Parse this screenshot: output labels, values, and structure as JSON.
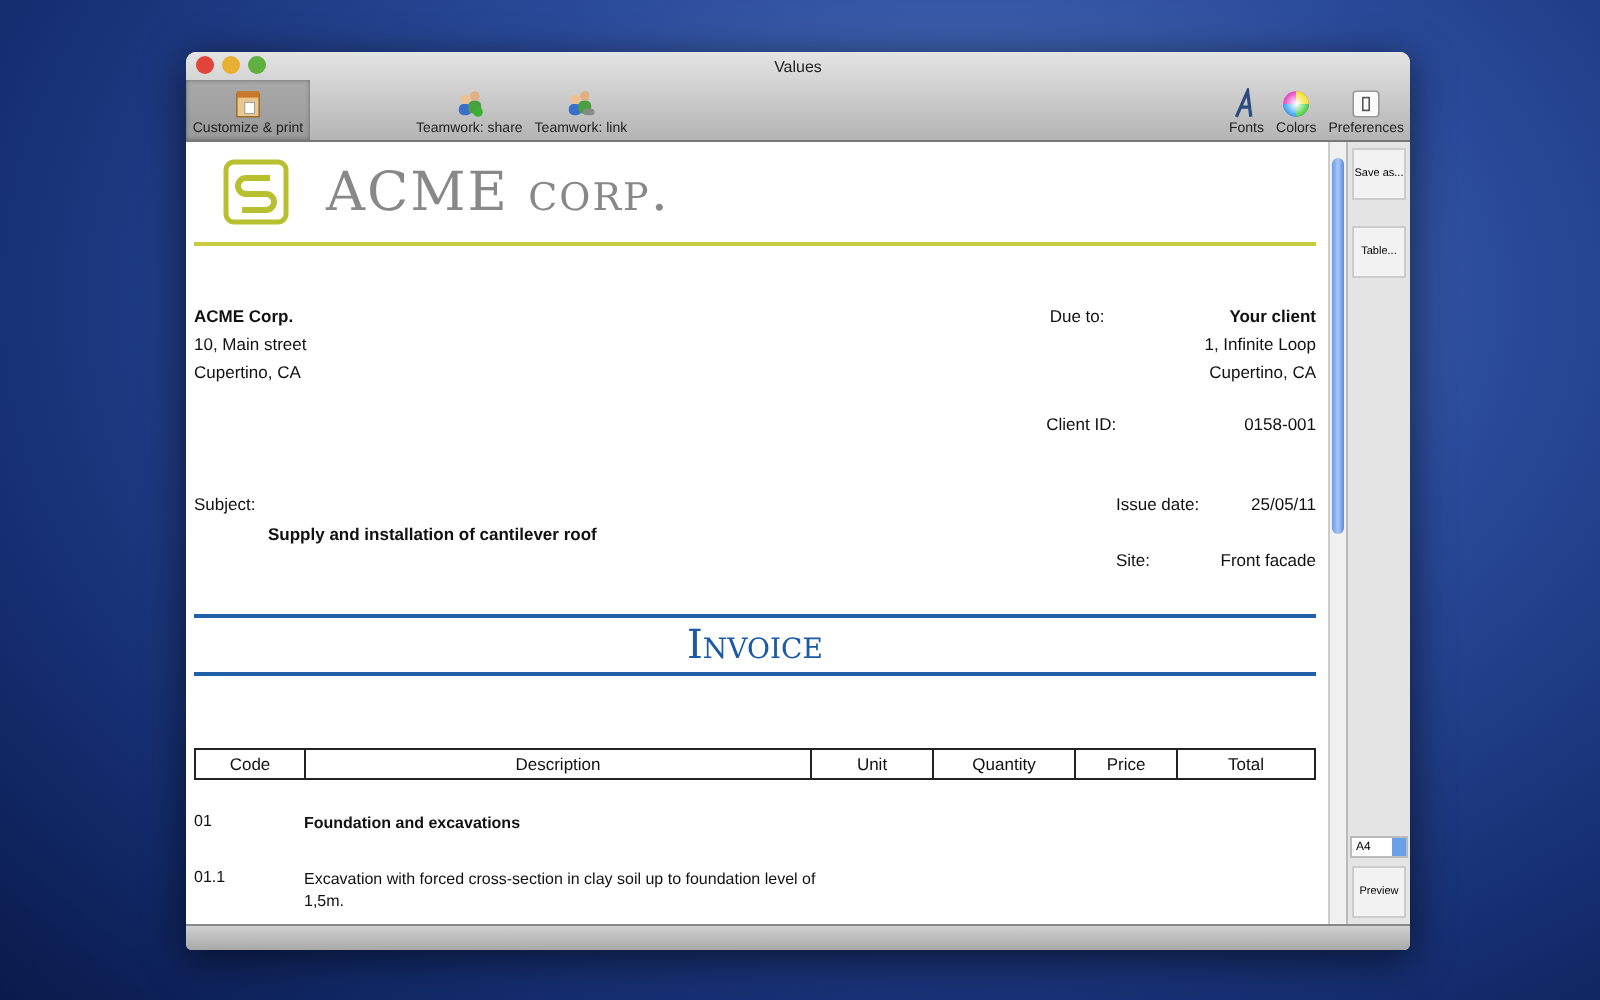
{
  "window": {
    "title": "Values"
  },
  "toolbar": {
    "items": [
      {
        "label": "Customize & print",
        "selected": true,
        "kind": "print"
      },
      {
        "label": "Teamwork: share",
        "selected": false,
        "kind": "share"
      },
      {
        "label": "Teamwork: link",
        "selected": false,
        "kind": "link"
      }
    ],
    "right_items": [
      {
        "label": "Fonts",
        "kind": "fonts"
      },
      {
        "label": "Colors",
        "kind": "colors"
      },
      {
        "label": "Preferences",
        "kind": "prefs"
      }
    ]
  },
  "document": {
    "logo": {
      "name": "ACME",
      "suffix": "corp."
    },
    "sender": [
      "ACME Corp.",
      "10, Main street",
      "Cupertino, CA"
    ],
    "due_label": "Due to:",
    "client": [
      "Your client",
      "1, Infinite Loop",
      "Cupertino, CA"
    ],
    "client_id": {
      "label": "Client ID:",
      "value": "0158-001"
    },
    "subject": {
      "label": "Subject:",
      "value": "Supply and installation of cantilever roof"
    },
    "issue_date": {
      "label": "Issue date:",
      "value": "25/05/11"
    },
    "site": {
      "label": "Site:",
      "value": "Front facade"
    },
    "title": "Invoice",
    "table": {
      "columns": [
        "Code",
        "Description",
        "Unit",
        "Quantity",
        "Price",
        "Total"
      ],
      "rows": [
        {
          "code": "01",
          "description": "Foundation and excavations",
          "kind": "heading"
        },
        {
          "code": "01.1",
          "description": "Excavation with forced cross-section in clay soil up to foundation level of 1,5m.",
          "kind": "item"
        }
      ]
    }
  },
  "side_panel": {
    "buttons": [
      "Save as...",
      "Table..."
    ],
    "paper_size": "A4",
    "preview": "Preview"
  }
}
